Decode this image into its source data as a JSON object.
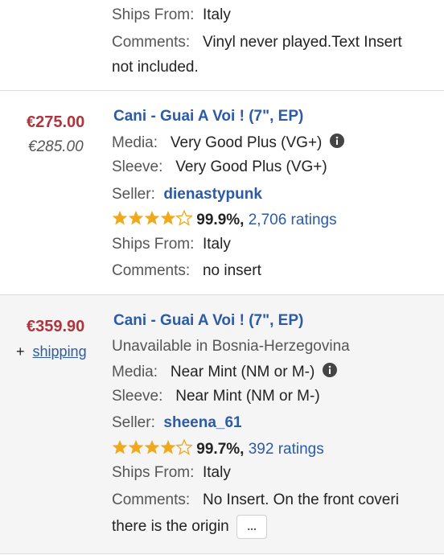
{
  "top": {
    "ships_from_label": "Ships From:",
    "ships_from_value": "Italy",
    "comments_label": "Comments:",
    "comments_value_1": "Vinyl never played.Text Insert",
    "comments_value_2": "not included."
  },
  "listing1": {
    "price": "€275.00",
    "original_price": "€285.00",
    "title": "Cani - Guai A Voi ! (7\", EP)",
    "media_label": "Media:",
    "media_value": "Very Good Plus (VG+)",
    "sleeve_label": "Sleeve:",
    "sleeve_value": "Very Good Plus (VG+)",
    "seller_label": "Seller:",
    "seller_name": "dienastypunk",
    "rating_percent": "99.9%,",
    "ratings_count": "2,706 ratings",
    "stars": 4.5,
    "ships_from_label": "Ships From:",
    "ships_from_value": "Italy",
    "comments_label": "Comments:",
    "comments_value": "no insert"
  },
  "listing2": {
    "price": "€359.90",
    "shipping_prefix": "+",
    "shipping_link": "shipping",
    "title": "Cani - Guai A Voi ! (7\", EP)",
    "availability": "Unavailable in Bosnia-Herzegovina",
    "media_label": "Media:",
    "media_value": "Near Mint (NM or M-)",
    "sleeve_label": "Sleeve:",
    "sleeve_value": "Near Mint (NM or M-)",
    "seller_label": "Seller:",
    "seller_name": "sheena_61",
    "rating_percent": "99.7%,",
    "ratings_count": "392 ratings",
    "stars": 4.5,
    "ships_from_label": "Ships From:",
    "ships_from_value": "Italy",
    "comments_label": "Comments:",
    "comments_value_1": "No Insert. On the front coveri",
    "comments_value_2": "there is the origin",
    "more_label": "..."
  },
  "colors": {
    "price": "#b0343c",
    "link": "#2b5ba8",
    "star": "#f0a81c",
    "listing2_bg": "#f5f5f5"
  }
}
